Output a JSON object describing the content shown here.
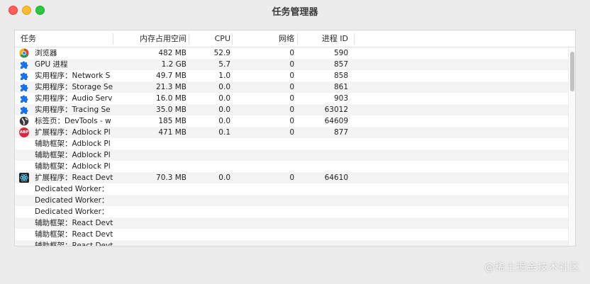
{
  "window": {
    "title": "任务管理器"
  },
  "columns": {
    "task": "任务",
    "memory": "内存占用空间",
    "cpu": "CPU",
    "network": "网络",
    "pid": "进程 ID"
  },
  "rows": [
    {
      "icon": "chrome-icon",
      "name": "浏览器",
      "memory": "482 MB",
      "cpu": "52.9",
      "network": "0",
      "pid": "590"
    },
    {
      "icon": "puzzle-icon",
      "name": "GPU 进程",
      "memory": "1.2 GB",
      "cpu": "5.7",
      "network": "0",
      "pid": "857"
    },
    {
      "icon": "puzzle-icon",
      "name": "实用程序：Network S",
      "memory": "49.7 MB",
      "cpu": "1.0",
      "network": "0",
      "pid": "858"
    },
    {
      "icon": "puzzle-icon",
      "name": "实用程序：Storage Se",
      "memory": "21.3 MB",
      "cpu": "0.0",
      "network": "0",
      "pid": "861"
    },
    {
      "icon": "puzzle-icon",
      "name": "实用程序：Audio Serv",
      "memory": "16.0 MB",
      "cpu": "0.0",
      "network": "0",
      "pid": "903"
    },
    {
      "icon": "puzzle-icon",
      "name": "实用程序：Tracing Se",
      "memory": "35.0 MB",
      "cpu": "0.0",
      "network": "0",
      "pid": "63012"
    },
    {
      "icon": "globe-icon",
      "name": "标签页：DevTools - w",
      "memory": "185 MB",
      "cpu": "0.0",
      "network": "0",
      "pid": "64609"
    },
    {
      "icon": "abp-icon",
      "icon_text": "ABP",
      "name": "扩展程序：Adblock Pl",
      "memory": "471 MB",
      "cpu": "0.1",
      "network": "0",
      "pid": "877"
    },
    {
      "icon": "",
      "name": "辅助框架：Adblock Pl",
      "memory": "",
      "cpu": "",
      "network": "",
      "pid": ""
    },
    {
      "icon": "",
      "name": "辅助框架：Adblock Pl",
      "memory": "",
      "cpu": "",
      "network": "",
      "pid": ""
    },
    {
      "icon": "",
      "name": "辅助框架：Adblock Pl",
      "memory": "",
      "cpu": "",
      "network": "",
      "pid": ""
    },
    {
      "icon": "react-icon",
      "name": "扩展程序：React Devt",
      "memory": "70.3 MB",
      "cpu": "0.0",
      "network": "0",
      "pid": "64610"
    },
    {
      "icon": "",
      "name": "Dedicated Worker：",
      "memory": "",
      "cpu": "",
      "network": "",
      "pid": ""
    },
    {
      "icon": "",
      "name": "Dedicated Worker：",
      "memory": "",
      "cpu": "",
      "network": "",
      "pid": ""
    },
    {
      "icon": "",
      "name": "Dedicated Worker：",
      "memory": "",
      "cpu": "",
      "network": "",
      "pid": ""
    },
    {
      "icon": "",
      "name": "辅助框架：React Devt",
      "memory": "",
      "cpu": "",
      "network": "",
      "pid": ""
    },
    {
      "icon": "",
      "name": "辅助框架：React Devt",
      "memory": "",
      "cpu": "",
      "network": "",
      "pid": ""
    },
    {
      "icon": "",
      "name": "辅助框架：React Devt",
      "memory": "",
      "cpu": "",
      "network": "",
      "pid": ""
    }
  ],
  "watermark": "@稀土掘金技术社区",
  "colors": {
    "close": "#fe5f57",
    "minimize": "#febc2e",
    "zoom": "#28c840",
    "puzzle_blue": "#1a73e8",
    "abp_red": "#d8283a",
    "react_cyan": "#61dafb"
  }
}
